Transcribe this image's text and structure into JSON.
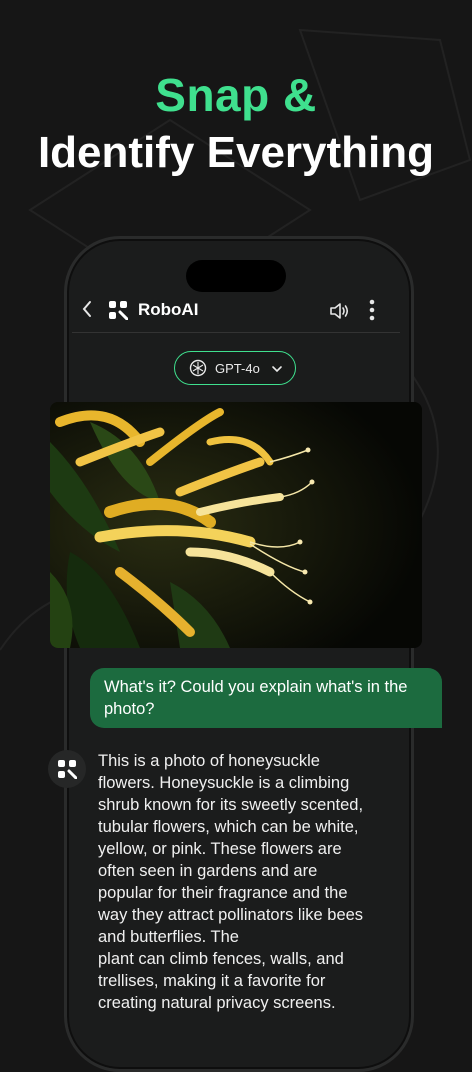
{
  "headline": {
    "line1": "Snap &",
    "line2": "Identify Everything"
  },
  "topbar": {
    "back_icon": "chevron-left-icon",
    "title": "RoboAI",
    "speaker_icon": "speaker-icon",
    "menu_icon": "more-vertical-icon"
  },
  "model_selector": {
    "label": "GPT-4o",
    "icon": "openai-icon"
  },
  "chat": {
    "user_message": "What's it? Could you explain what's in the photo?",
    "assistant_message": "This is a photo of honeysuckle\nflowers. Honeysuckle is a climbing\nshrub known for its sweetly scented,\ntubular flowers, which can be white,\nyellow, or pink. These flowers are\noften seen in gardens and are\npopular for their fragrance and the\nway they attract pollinators like bees\nand butterflies. The\nplant can climb fences, walls, and\ntrellises, making it a favorite for\ncreating natural privacy screens."
  },
  "colors": {
    "accent": "#3fe08e",
    "user_bubble": "#1c6b3f",
    "background": "#161616"
  }
}
